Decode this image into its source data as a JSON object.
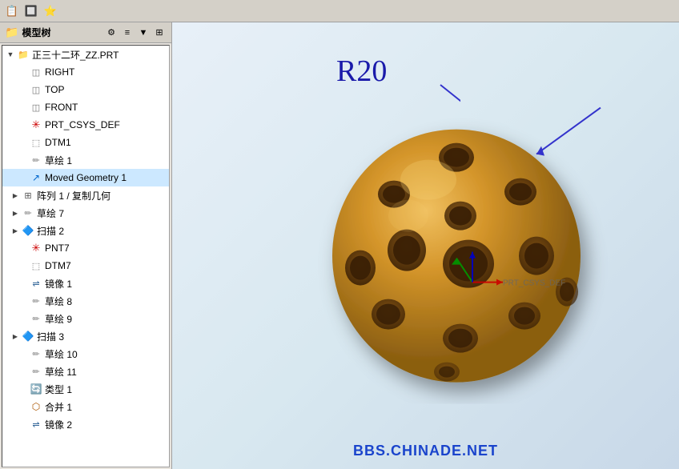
{
  "toolbar": {
    "title": "模型树",
    "icons": [
      "model-tree-icon",
      "settings-icon",
      "columns-icon",
      "filter-icon",
      "more-icon"
    ]
  },
  "tree": {
    "root": "正三十二环_ZZ.PRT",
    "items": [
      {
        "id": "right",
        "label": "RIGHT",
        "icon": "plane",
        "indent": 1,
        "expandable": false
      },
      {
        "id": "top",
        "label": "TOP",
        "icon": "plane",
        "indent": 1,
        "expandable": false
      },
      {
        "id": "front",
        "label": "FRONT",
        "icon": "plane",
        "indent": 1,
        "expandable": false
      },
      {
        "id": "csys",
        "label": "PRT_CSYS_DEF",
        "icon": "csys",
        "indent": 1,
        "expandable": false
      },
      {
        "id": "dtm1",
        "label": "DTM1",
        "icon": "datum",
        "indent": 1,
        "expandable": false
      },
      {
        "id": "sketch1",
        "label": "草绘 1",
        "icon": "sketch",
        "indent": 1,
        "expandable": false
      },
      {
        "id": "moved",
        "label": "Moved Geometry 1",
        "icon": "move",
        "indent": 1,
        "expandable": false
      },
      {
        "id": "pattern1",
        "label": "阵列 1 / 复制几何",
        "icon": "pattern",
        "indent": 1,
        "expandable": true
      },
      {
        "id": "sketch7",
        "label": "草绘 7",
        "icon": "sketch",
        "indent": 1,
        "expandable": true
      },
      {
        "id": "sweep2",
        "label": "扫描 2",
        "icon": "sweep",
        "indent": 1,
        "expandable": true
      },
      {
        "id": "pnt7",
        "label": "PNT7",
        "icon": "point",
        "indent": 1,
        "expandable": false
      },
      {
        "id": "dtm7",
        "label": "DTM7",
        "icon": "datum",
        "indent": 1,
        "expandable": false
      },
      {
        "id": "mirror1",
        "label": "镜像 1",
        "icon": "mirror",
        "indent": 1,
        "expandable": false
      },
      {
        "id": "sketch8",
        "label": "草绘 8",
        "icon": "sketch",
        "indent": 1,
        "expandable": false
      },
      {
        "id": "sketch9",
        "label": "草绘 9",
        "icon": "sketch",
        "indent": 1,
        "expandable": false
      },
      {
        "id": "sweep3",
        "label": "扫描 3",
        "icon": "sweep",
        "indent": 1,
        "expandable": true
      },
      {
        "id": "sketch10",
        "label": "草绘 10",
        "icon": "sketch",
        "indent": 1,
        "expandable": false
      },
      {
        "id": "sketch11",
        "label": "草绘 11",
        "icon": "sketch",
        "indent": 1,
        "expandable": false
      },
      {
        "id": "type1",
        "label": "类型 1",
        "icon": "type",
        "indent": 1,
        "expandable": false
      },
      {
        "id": "combine1",
        "label": "合并 1",
        "icon": "combine",
        "indent": 1,
        "expandable": false
      },
      {
        "id": "mirror2",
        "label": "镜像 2",
        "icon": "mirror",
        "indent": 1,
        "expandable": false
      }
    ]
  },
  "viewport": {
    "annotation": "R20",
    "watermark": "BBS.CHINADE.NET",
    "axis_label": "PRT_CSYS_DEF"
  }
}
